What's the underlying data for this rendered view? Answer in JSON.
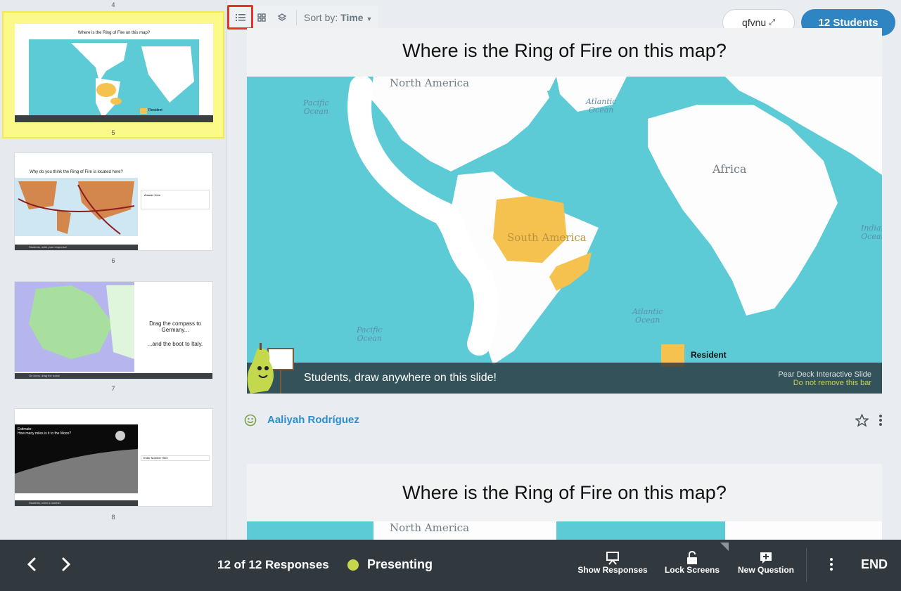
{
  "sidebar": {
    "slides": [
      {
        "number": "4"
      },
      {
        "number": "5",
        "title": "Where is the Ring of Fire on this map?",
        "bar": "Students, draw anywhere on this slide!",
        "legend": "Resident"
      },
      {
        "number": "6",
        "title": "Why do you think the Ring of Fire is located here?",
        "side_note": "Answer Here",
        "bar": "Students, write your response!"
      },
      {
        "number": "7",
        "text1": "Drag the compass to Germany...",
        "text2": "...and the boot to Italy.",
        "bar": "On icons, drag the icons!"
      },
      {
        "number": "8",
        "title": "Estimate:\nHow many miles is it to the Moon?",
        "side_note": "Enter Number Here",
        "bar": "Students, enter a number"
      }
    ]
  },
  "toolbar": {
    "sort_label": "Sort by:",
    "sort_value": "Time"
  },
  "header": {
    "session_code": "qfvnu",
    "students_label": "12 Students"
  },
  "main": {
    "question_title": "Where is the Ring of Fire on this map?",
    "map_labels": {
      "north_america": "North America",
      "south_america": "South America",
      "africa": "Africa",
      "pacific_ocean_1": "Pacific\nOcean",
      "pacific_ocean_2": "Pacific\nOcean",
      "atlantic_ocean_1": "Atlantic\nOcean",
      "atlantic_ocean_2": "Atlantic\nOcean",
      "indian_ocean": "Indian\nOcean"
    },
    "legend_label": "Resident",
    "bar_text": "Students, draw anywhere on this slide!",
    "bar_right_1": "Pear Deck Interactive Slide",
    "bar_right_2": "Do not remove this bar",
    "student_name": "Aaliyah Rodríguez",
    "second_card_title": "Where is the Ring of Fire on this map?",
    "second_card_map_label": "North America"
  },
  "bottom_bar": {
    "responses": "12 of 12 Responses",
    "presenting": "Presenting",
    "show_responses": "Show Responses",
    "lock_screens": "Lock Screens",
    "new_question": "New Question",
    "end": "END"
  },
  "colors": {
    "accent_blue": "#2f84c2",
    "highlight_red": "#e53427",
    "presenting_green": "#c5d84c",
    "selected_yellow": "#fbf98a",
    "resident_orange": "#f6c24f"
  }
}
